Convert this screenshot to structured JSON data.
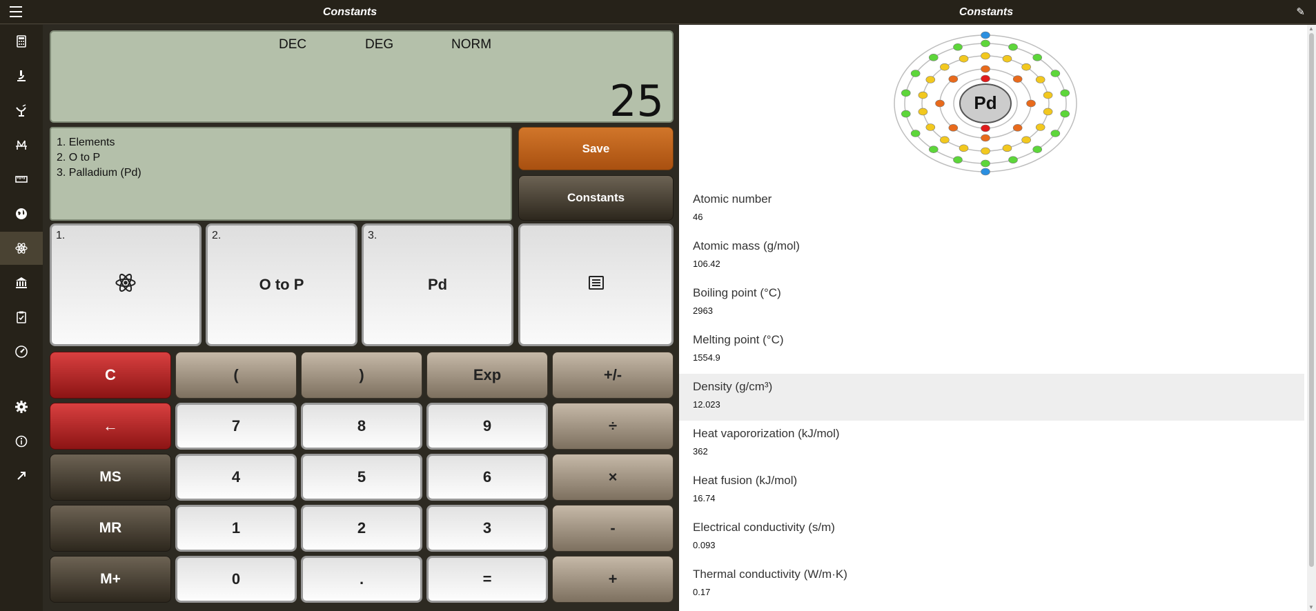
{
  "titlebar": {
    "left_title": "Constants",
    "right_title": "Constants"
  },
  "sidebar": {
    "items": [
      {
        "icon": "calculator-icon"
      },
      {
        "icon": "microscope-icon"
      },
      {
        "icon": "satellite-dish-icon"
      },
      {
        "icon": "bridge-icon"
      },
      {
        "icon": "ruler-icon"
      },
      {
        "icon": "globe-icon"
      },
      {
        "icon": "atom-icon",
        "active": true
      },
      {
        "icon": "bank-icon"
      },
      {
        "icon": "clipboard-icon"
      },
      {
        "icon": "gauge-icon"
      },
      {
        "icon": "gear-icon"
      },
      {
        "icon": "info-icon"
      },
      {
        "icon": "expand-icon"
      }
    ]
  },
  "display": {
    "modes": [
      "DEC",
      "DEG",
      "NORM"
    ],
    "value": "25"
  },
  "history": {
    "lines": [
      "1. Elements",
      "2. O to P",
      "3. Palladium (Pd)"
    ]
  },
  "actions": {
    "save": "Save",
    "constants": "Constants"
  },
  "nav": [
    {
      "num": "1.",
      "label": "",
      "icon": "atom-icon"
    },
    {
      "num": "2.",
      "label": "O to P"
    },
    {
      "num": "3.",
      "label": "Pd"
    },
    {
      "num": "",
      "label": "",
      "icon": "list-icon"
    }
  ],
  "keypad": {
    "row1": [
      "C",
      "(",
      ")",
      "Exp",
      "+/-"
    ],
    "row2": [
      "←",
      "7",
      "8",
      "9",
      "÷"
    ],
    "row3": [
      "MS",
      "4",
      "5",
      "6",
      "×"
    ],
    "row4": [
      "MR",
      "1",
      "2",
      "3",
      "-"
    ],
    "row5": [
      "M+",
      "0",
      ".",
      "=",
      "+"
    ]
  },
  "element": {
    "symbol": "Pd",
    "properties": [
      {
        "label": "Atomic number",
        "value": "46"
      },
      {
        "label": "Atomic mass (g/mol)",
        "value": "106.42"
      },
      {
        "label": "Boiling point (°C)",
        "value": "2963"
      },
      {
        "label": "Melting point (°C)",
        "value": "1554.9"
      },
      {
        "label": "Density (g/cm³)",
        "value": "12.023",
        "highlight": true
      },
      {
        "label": "Heat vapororization (kJ/mol)",
        "value": "362"
      },
      {
        "label": "Heat fusion (kJ/mol)",
        "value": "16.74"
      },
      {
        "label": "Electrical conductivity (s/m)",
        "value": "0.093"
      },
      {
        "label": "Thermal conductivity (W/m·K)",
        "value": "0.17"
      }
    ]
  },
  "colors": {
    "display_bg": "#b4c0aa",
    "save_orange": "#c0651c",
    "clear_red": "#b02020",
    "sidebar_bg": "#262219"
  }
}
